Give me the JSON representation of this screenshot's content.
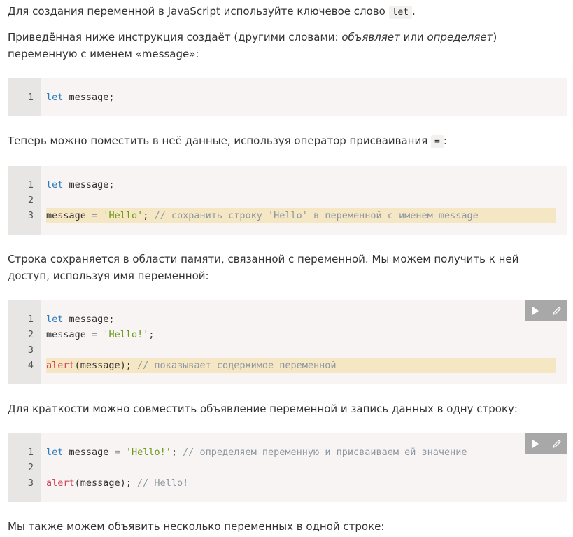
{
  "paragraphs": {
    "p1": {
      "text": "Для создания переменной в JavaScript используйте ключевое слово",
      "code": "let",
      "end": "."
    },
    "p2": {
      "part1": "Приведённая ниже инструкция создаёт (другими словами: ",
      "em1": "объявляет",
      "part2": " или ",
      "em2": "определяет",
      "part3": ") переменную с именем «message»:"
    },
    "p3": {
      "text": "Теперь можно поместить в неё данные, используя оператор присваивания",
      "code": "=",
      "end": ":"
    },
    "p4": {
      "text": "Строка сохраняется в области памяти, связанной с переменной. Мы можем получить к ней доступ, используя имя переменной:"
    },
    "p5": {
      "text": "Для краткости можно совместить объявление переменной и запись данных в одну строку:"
    },
    "p6": {
      "text": "Мы также можем объявить несколько переменных в одной строке:"
    }
  },
  "code_blocks": [
    {
      "lines": [
        {
          "n": "1",
          "tokens": [
            {
              "t": "let",
              "c": "kw"
            },
            {
              "t": " message;",
              "c": ""
            }
          ]
        }
      ]
    },
    {
      "lines": [
        {
          "n": "1",
          "tokens": [
            {
              "t": "let",
              "c": "kw"
            },
            {
              "t": " message;",
              "c": ""
            }
          ]
        },
        {
          "n": "2",
          "tokens": []
        },
        {
          "n": "3",
          "highlight": true,
          "tokens": [
            {
              "t": "message ",
              "c": ""
            },
            {
              "t": "=",
              "c": "op"
            },
            {
              "t": " ",
              "c": ""
            },
            {
              "t": "'Hello'",
              "c": "str"
            },
            {
              "t": "; ",
              "c": ""
            },
            {
              "t": "// сохранить строку 'Hello' в переменной с именем message",
              "c": "cm"
            }
          ]
        }
      ]
    },
    {
      "tools": true,
      "lines": [
        {
          "n": "1",
          "tokens": [
            {
              "t": "let",
              "c": "kw"
            },
            {
              "t": " message;",
              "c": ""
            }
          ]
        },
        {
          "n": "2",
          "tokens": [
            {
              "t": "message ",
              "c": ""
            },
            {
              "t": "=",
              "c": "op"
            },
            {
              "t": " ",
              "c": ""
            },
            {
              "t": "'Hello!'",
              "c": "str"
            },
            {
              "t": ";",
              "c": ""
            }
          ]
        },
        {
          "n": "3",
          "tokens": []
        },
        {
          "n": "4",
          "highlight": true,
          "tokens": [
            {
              "t": "alert",
              "c": "fn"
            },
            {
              "t": "(message); ",
              "c": ""
            },
            {
              "t": "// показывает содержимое переменной",
              "c": "cm"
            }
          ]
        }
      ]
    },
    {
      "tools": true,
      "lines": [
        {
          "n": "1",
          "tokens": [
            {
              "t": "let",
              "c": "kw"
            },
            {
              "t": " message ",
              "c": ""
            },
            {
              "t": "=",
              "c": "op"
            },
            {
              "t": " ",
              "c": ""
            },
            {
              "t": "'Hello!'",
              "c": "str"
            },
            {
              "t": "; ",
              "c": ""
            },
            {
              "t": "// определяем переменную и присваиваем ей значение",
              "c": "cm"
            }
          ]
        },
        {
          "n": "2",
          "tokens": []
        },
        {
          "n": "3",
          "tokens": [
            {
              "t": "alert",
              "c": "fn"
            },
            {
              "t": "(message); ",
              "c": ""
            },
            {
              "t": "// Hello!",
              "c": "cm"
            }
          ]
        }
      ]
    }
  ],
  "icons": {
    "run": "play-icon",
    "edit": "pencil-icon"
  },
  "colors": {
    "keyword": "#2a7bbd",
    "string": "#6b9a1c",
    "comment": "#8c97a1",
    "function": "#d2455a",
    "highlight": "#f5e6c4",
    "code_bg": "#f7f4f3",
    "gutter_bg": "#e8e6e5",
    "tool_bg": "#a8a8a8"
  }
}
